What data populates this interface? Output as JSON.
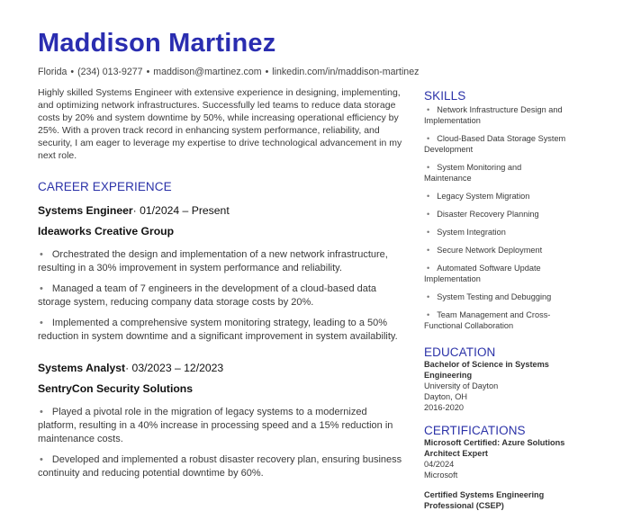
{
  "header": {
    "name": "Maddison Martinez",
    "contact": {
      "location": "Florida",
      "phone": "(234) 013-9277",
      "email": "maddison@martinez.com",
      "linkedin": "linkedin.com/in/maddison-martinez",
      "separator": "•"
    }
  },
  "summary": "Highly skilled Systems Engineer with extensive experience in designing, implementing, and optimizing network infrastructures. Successfully led teams to reduce data storage costs by 20% and system downtime by 50%, while increasing operational efficiency by 25%. With a proven track record in enhancing system performance, reliability, and security, I am eager to leverage my expertise to drive technological advancement in my next role.",
  "experience": {
    "title": "CAREER EXPERIENCE",
    "jobs": [
      {
        "role": "Systems Engineer",
        "dates": "· 01/2024 – Present",
        "company": "Ideaworks Creative Group",
        "bullets": [
          "Orchestrated the design and implementation of a new network infrastructure, resulting in a 30% improvement in system performance and reliability.",
          "Managed a team of 7 engineers in the development of a cloud-based data storage system, reducing company data storage costs by 20%.",
          "Implemented a comprehensive system monitoring strategy, leading to a 50% reduction in system downtime and a significant improvement in system availability."
        ]
      },
      {
        "role": "Systems Analyst",
        "dates": "· 03/2023 – 12/2023",
        "company": "SentryCon Security Solutions",
        "bullets": [
          "Played a pivotal role in the migration of legacy systems to a modernized platform, resulting in a 40% increase in processing speed and a 15% reduction in maintenance costs.",
          "Developed and implemented a robust disaster recovery plan, ensuring business continuity and reducing potential downtime by 60%."
        ]
      }
    ]
  },
  "skills": {
    "title": "SKILLS",
    "items": [
      "Network Infrastructure Design and Implementation",
      "Cloud-Based Data Storage System Development",
      "System Monitoring and Maintenance",
      "Legacy System Migration",
      "Disaster Recovery Planning",
      "System Integration",
      "Secure Network Deployment",
      "Automated Software Update Implementation",
      "System Testing and Debugging",
      "Team Management and Cross-Functional Collaboration"
    ]
  },
  "education": {
    "title": "EDUCATION",
    "degree": "Bachelor of Science in Systems Engineering",
    "school": "University of Dayton",
    "location": "Dayton, OH",
    "years": "2016-2020"
  },
  "certifications": {
    "title": "CERTIFICATIONS",
    "items": [
      {
        "name": "Microsoft Certified: Azure Solutions Architect Expert",
        "date": "04/2024",
        "issuer": "Microsoft"
      },
      {
        "name": "Certified Systems Engineering Professional (CSEP)"
      }
    ]
  },
  "colors": {
    "accent": "#2a2db0",
    "heading": "#2b32a8",
    "text": "#3a3a3a"
  }
}
